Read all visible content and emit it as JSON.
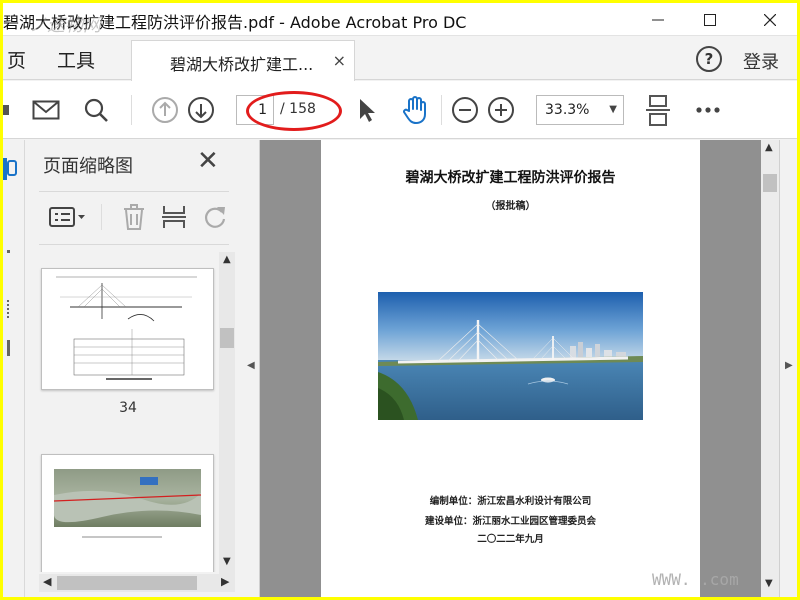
{
  "window": {
    "title": "碧湖大桥改扩建工程防洪评价报告.pdf - Adobe Acrobat Pro DC",
    "minimize_icon": "minimize-icon",
    "maximize_icon": "maximize-icon",
    "close_icon": "close-icon"
  },
  "tabs": {
    "home_label": "页",
    "tools_label": "工具",
    "document_tab_label": "碧湖大桥改扩建工...",
    "help_label": "?",
    "login_label": "登录"
  },
  "toolbar": {
    "current_page": "1",
    "total_pages": "/ 158",
    "zoom": "33.3%"
  },
  "thumbnail_panel": {
    "title": "页面缩略图",
    "thumbnails": [
      {
        "page_number": "34"
      }
    ]
  },
  "document": {
    "title": "碧湖大桥改扩建工程防洪评价报告",
    "subtitle": "（报批稿）",
    "compiled_by": "编制单位：浙江宏昌水利设计有限公司",
    "built_by": "建设单位：浙江丽水工业园区管理委员会",
    "date": "二〇二二年九月"
  },
  "watermark": {
    "top_left": "ノ速物网",
    "bottom_right": "WWW.   .com"
  },
  "colors": {
    "highlight_oval": "#e21c1c",
    "accent_hand": "#1a73c8",
    "border": "#ffff00"
  }
}
